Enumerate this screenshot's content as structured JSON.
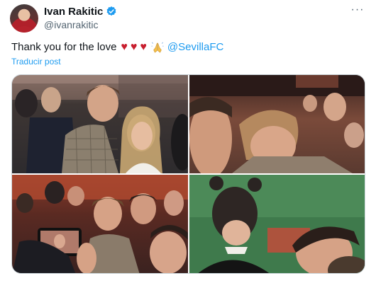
{
  "author": {
    "name": "Ivan Rakitic",
    "handle": "@ivanrakitic"
  },
  "post": {
    "text_prefix": "Thank you for the love",
    "heart": "♥",
    "mention": "@SevillaFC",
    "translate_label": "Traducir post"
  },
  "menu": {
    "more_label": "···"
  },
  "colors": {
    "accent": "#1d9bf0",
    "heart": "#c81e2e",
    "secondary_text": "#536471"
  },
  "media": {
    "photo_count": 4
  }
}
